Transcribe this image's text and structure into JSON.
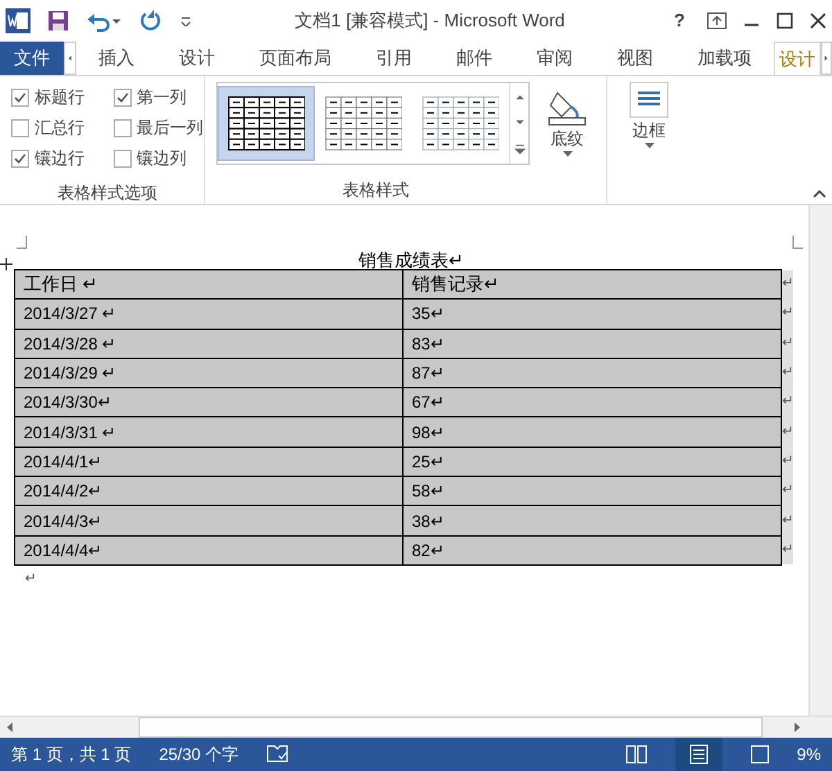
{
  "window": {
    "title": "文档1 [兼容模式] - Microsoft Word"
  },
  "help_button": "?",
  "tabs": [
    {
      "label": "文件",
      "kind": "file",
      "selected": false
    },
    {
      "label": "插入",
      "kind": "tab",
      "selected": false
    },
    {
      "label": "设计",
      "kind": "tab",
      "selected": false
    },
    {
      "label": "页面布局",
      "kind": "tab",
      "selected": false
    },
    {
      "label": "引用",
      "kind": "tab",
      "selected": false
    },
    {
      "label": "邮件",
      "kind": "tab",
      "selected": false
    },
    {
      "label": "审阅",
      "kind": "tab",
      "selected": false
    },
    {
      "label": "视图",
      "kind": "tab",
      "selected": false
    },
    {
      "label": "加载项",
      "kind": "tab",
      "selected": false
    },
    {
      "label": "设计",
      "kind": "context",
      "selected": true
    }
  ],
  "style_options": {
    "label": "表格样式选项",
    "items": [
      {
        "label": "标题行",
        "checked": true
      },
      {
        "label": "第一列",
        "checked": true
      },
      {
        "label": "汇总行",
        "checked": false
      },
      {
        "label": "最后一列",
        "checked": false
      },
      {
        "label": "镶边行",
        "checked": true
      },
      {
        "label": "镶边列",
        "checked": false
      }
    ]
  },
  "table_styles": {
    "label": "表格样式",
    "styles": [
      {
        "selected": true
      },
      {
        "selected": false
      },
      {
        "selected": false
      }
    ],
    "shading": "底纹",
    "borders": "边框"
  },
  "document": {
    "title": "销售成绩表↵",
    "columns": [
      "工作日 ↵",
      "销售记录↵"
    ],
    "rows": [
      [
        "2014/3/27 ↵",
        "35↵"
      ],
      [
        "2014/3/28 ↵",
        "83↵"
      ],
      [
        "2014/3/29 ↵",
        "87↵"
      ],
      [
        "2014/3/30↵",
        "67↵"
      ],
      [
        "2014/3/31 ↵",
        "98↵"
      ],
      [
        "2014/4/1↵",
        "25↵"
      ],
      [
        "2014/4/2↵",
        "58↵"
      ],
      [
        "2014/4/3↵",
        "38↵"
      ],
      [
        "2014/4/4↵",
        "82↵"
      ]
    ],
    "row_end_mark": "↵",
    "after_mark": "↵"
  },
  "status_bar": {
    "page": "第 1 页，共 1 页",
    "words": "25/30 个字",
    "zoom": "9%"
  }
}
